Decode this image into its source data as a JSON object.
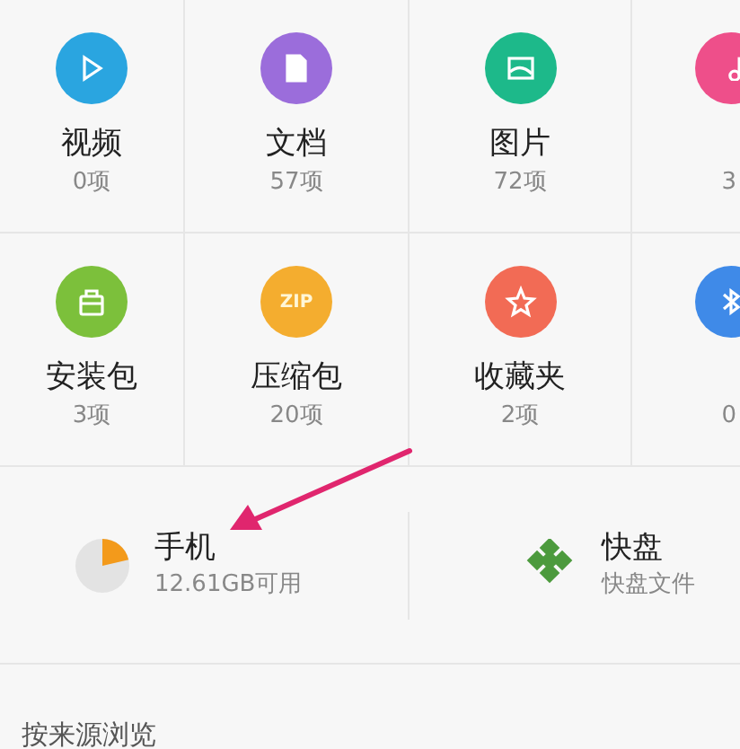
{
  "categories": [
    {
      "kind": "video",
      "label": "视频",
      "count": "0项",
      "color": "#2aa5e0"
    },
    {
      "kind": "document",
      "label": "文档",
      "count": "57项",
      "color": "#9b6ddb"
    },
    {
      "kind": "image",
      "label": "图片",
      "count": "72项",
      "color": "#1db98a"
    },
    {
      "kind": "music",
      "count": "3",
      "color": "#ee4f8a"
    },
    {
      "kind": "package",
      "label": "安装包",
      "count": "3项",
      "color": "#7cc03b"
    },
    {
      "kind": "zip",
      "icon_text": "ZIP",
      "label": "压缩包",
      "count": "20项",
      "color": "#f4ad2f"
    },
    {
      "kind": "favorite",
      "label": "收藏夹",
      "count": "2项",
      "color": "#f26b55"
    },
    {
      "kind": "bluetooth",
      "count": "0",
      "color": "#3f8ae8"
    }
  ],
  "storage": [
    {
      "kind": "phone",
      "title": "手机",
      "subtitle": "12.61GB可用"
    },
    {
      "kind": "cloud",
      "title": "快盘",
      "subtitle": "快盘文件"
    }
  ],
  "section_header": "按来源浏览"
}
